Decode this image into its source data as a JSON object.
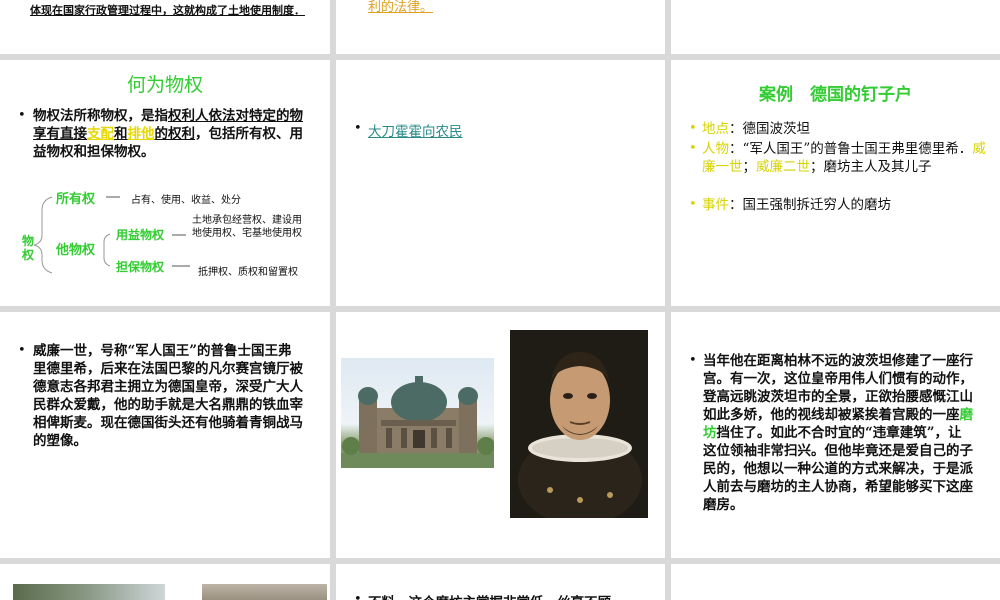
{
  "colors": {
    "background": "#d9d9d9",
    "slide": "#ffffff",
    "accent_green": "#33cc33",
    "accent_yellow": "#e6d800",
    "link_teal": "#2a8a8a",
    "orange": "#e0a020"
  },
  "slide_top_left": {
    "text": "体现在国家行政管理过程中，这就构成了土地使用制度．"
  },
  "slide_top_middle": {
    "text": "利的法律。"
  },
  "slide_what_is": {
    "title": "何为物权",
    "bullet_parts": [
      "物权法所称物权，是指",
      "权利人依法对特定的物享有直接",
      "支配",
      "和",
      "排他",
      "的权利",
      "，包括所有权、用益物权和担保物权。"
    ],
    "tree": {
      "root": "物权",
      "ownership": "所有权",
      "ownership_desc": "占有、使用、收益、处分",
      "other": "他物权",
      "usufruct": "用益物权",
      "usufruct_desc": "土地承包经营权、建设用地使用权、宅基地使用权",
      "security": "担保物权",
      "security_desc": "抵押权、质权和留置权"
    }
  },
  "slide_link": {
    "link_text": "大刀霍霍向农民"
  },
  "slide_case": {
    "title": "案例　德国的钉子户",
    "items": [
      {
        "label": "地点",
        "text": "德国波茨坦"
      },
      {
        "label": "人物",
        "text_parts": [
          "“军人国王”的普鲁士国王弗里德里希．",
          "威廉一世",
          "；",
          "威廉二世",
          "；磨坊主人及其儿子"
        ]
      },
      {
        "label": "事件",
        "text": "国王强制拆迁穷人的磨坊"
      }
    ]
  },
  "slide_wilhelm": {
    "text": "威廉一世，号称“军人国王”的普鲁士国王弗里德里希，后来在法国巴黎的凡尔赛宫镜厅被德意志各邦君主拥立为德国皇帝，深受广大人民群众爱戴，他的助手就是大名鼎鼎的铁血宰相俾斯麦。现在德国街头还有他骑着青铜战马的塑像。"
  },
  "slide_images": {
    "building_icon": "berlin-cathedral-image",
    "portrait_icon": "portrait-image"
  },
  "slide_story": {
    "text_before": "当年他在距离柏林不远的波茨坦修建了一座行宫。有一次，这位皇帝用伟人们惯有的动作，登高远眺波茨坦市的全景，正欲抬腰感慨江山如此多娇，他的视线却被紧挨着宫殿的一座",
    "highlight": "磨坊",
    "text_after": "挡住了。如此不合时宜的“违章建筑”，让这位领袖非常扫兴。但他毕竟还是爱自己的子民的，他想以一种公道的方式来解决，于是派人前去与磨坊的主人协商，希望能够买下这座磨房。"
  },
  "slide_bottom_middle": {
    "text": "不料，这个磨坊主掌握非掌低，丝毫不顾"
  }
}
